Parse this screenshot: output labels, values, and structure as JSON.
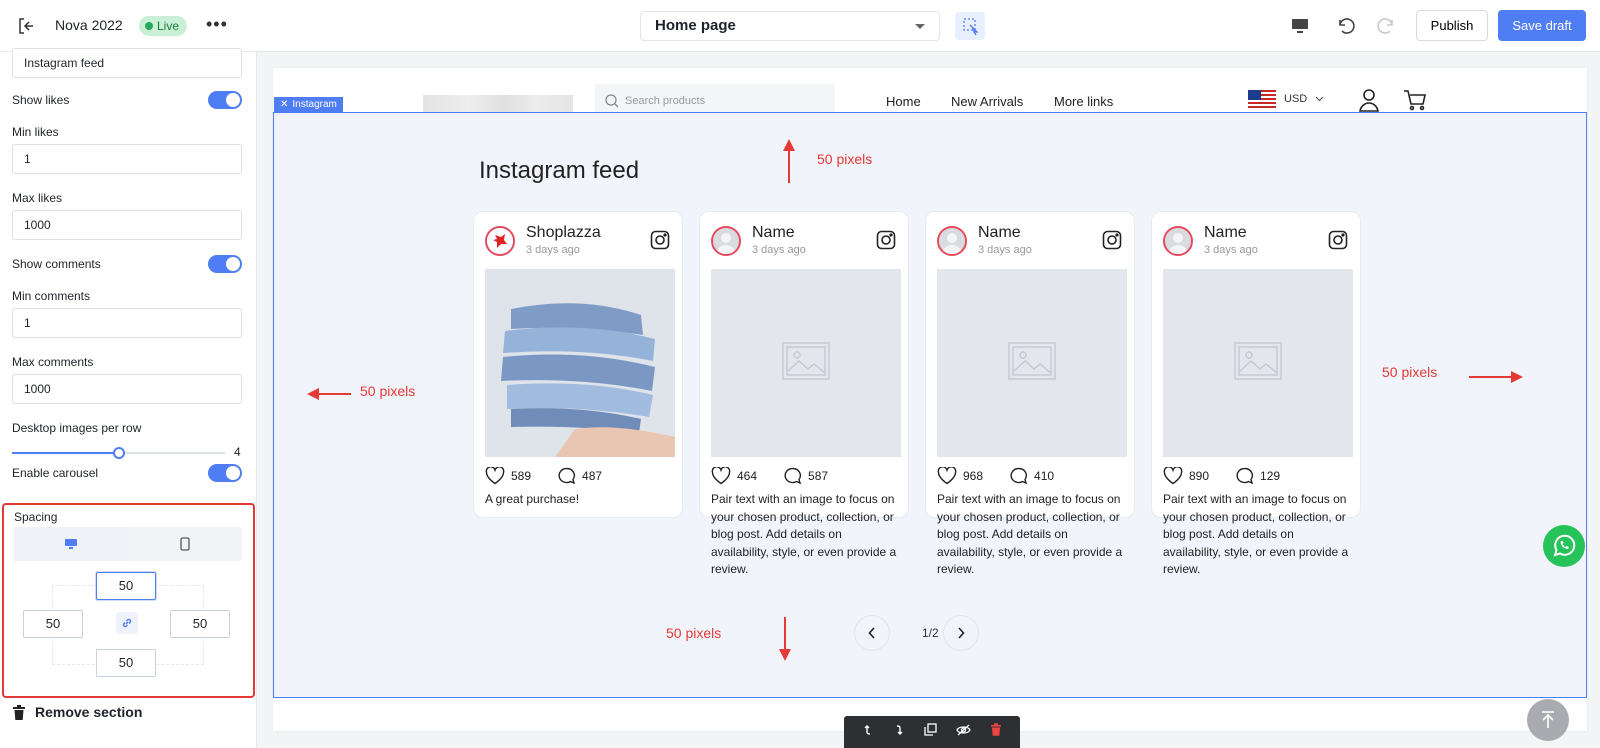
{
  "topbar": {
    "theme_name": "Nova 2022",
    "status": "Live",
    "more": "•••",
    "page_select": "Home page",
    "publish_label": "Publish",
    "save_label": "Save draft"
  },
  "sidebar": {
    "heading_value": "Instagram feed",
    "show_likes_label": "Show likes",
    "show_likes": true,
    "min_likes_label": "Min likes",
    "min_likes": "1",
    "max_likes_label": "Max likes",
    "max_likes": "1000",
    "show_comments_label": "Show comments",
    "show_comments": true,
    "min_comments_label": "Min comments",
    "min_comments": "1",
    "max_comments_label": "Max comments",
    "max_comments": "1000",
    "images_per_row_label": "Desktop images per row",
    "images_per_row": "4",
    "images_per_row_fraction": 0.5,
    "carousel_label": "Enable carousel",
    "carousel": true,
    "spacing_label": "Spacing",
    "spacing": {
      "top": "50",
      "left": "50",
      "right": "50",
      "bottom": "50"
    },
    "remove_label": "Remove section"
  },
  "store": {
    "search_placeholder": "Search products",
    "nav": [
      "Home",
      "New Arrivals",
      "More links"
    ],
    "currency": "USD"
  },
  "section": {
    "tag": "Instagram",
    "title": "Instagram feed",
    "pagination": "1/2",
    "cards": [
      {
        "name": "Shoplazza",
        "time": "3 days ago",
        "likes": "589",
        "comments": "487",
        "caption": "A great purchase!"
      },
      {
        "name": "Name",
        "time": "3 days ago",
        "likes": "464",
        "comments": "587",
        "caption": "Pair text with an image to focus on your chosen product, collection, or blog post. Add details on availability, style, or even provide a review."
      },
      {
        "name": "Name",
        "time": "3 days ago",
        "likes": "968",
        "comments": "410",
        "caption": "Pair text with an image to focus on your chosen product, collection, or blog post. Add details on availability, style, or even provide a review."
      },
      {
        "name": "Name",
        "time": "3 days ago",
        "likes": "890",
        "comments": "129",
        "caption": "Pair text with an image to focus on your chosen product, collection, or blog post. Add details on availability, style, or even provide a review."
      }
    ]
  },
  "annotations": {
    "top": "50 pixels",
    "left": "50 pixels",
    "right": "50 pixels",
    "bottom": "50 pixels",
    "color": "#e53935"
  },
  "colors": {
    "accent": "#4f7df3",
    "live": "#26a95a",
    "highlight": "#e53935"
  }
}
